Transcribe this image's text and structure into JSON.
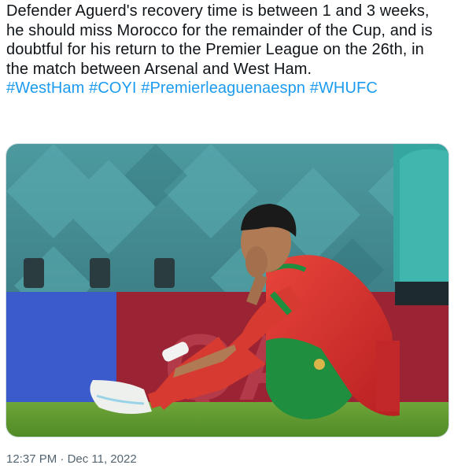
{
  "tweet": {
    "text": "Defender Aguerd's recovery time is between 1 and 3 weeks, he should miss Morocco for the remainder of the Cup, and is doubtful for his return to the Premier League on the 26th, in the match between Arsenal and West Ham.",
    "hashtags": [
      "#WestHam",
      "#COYI",
      "#Premierleaguenaespn",
      "#WHUFC"
    ],
    "time": "12:37 PM",
    "separator": "·",
    "date": "Dec 11, 2022"
  },
  "colors": {
    "hashtag": "#1d9bf0",
    "meta": "#536471"
  }
}
